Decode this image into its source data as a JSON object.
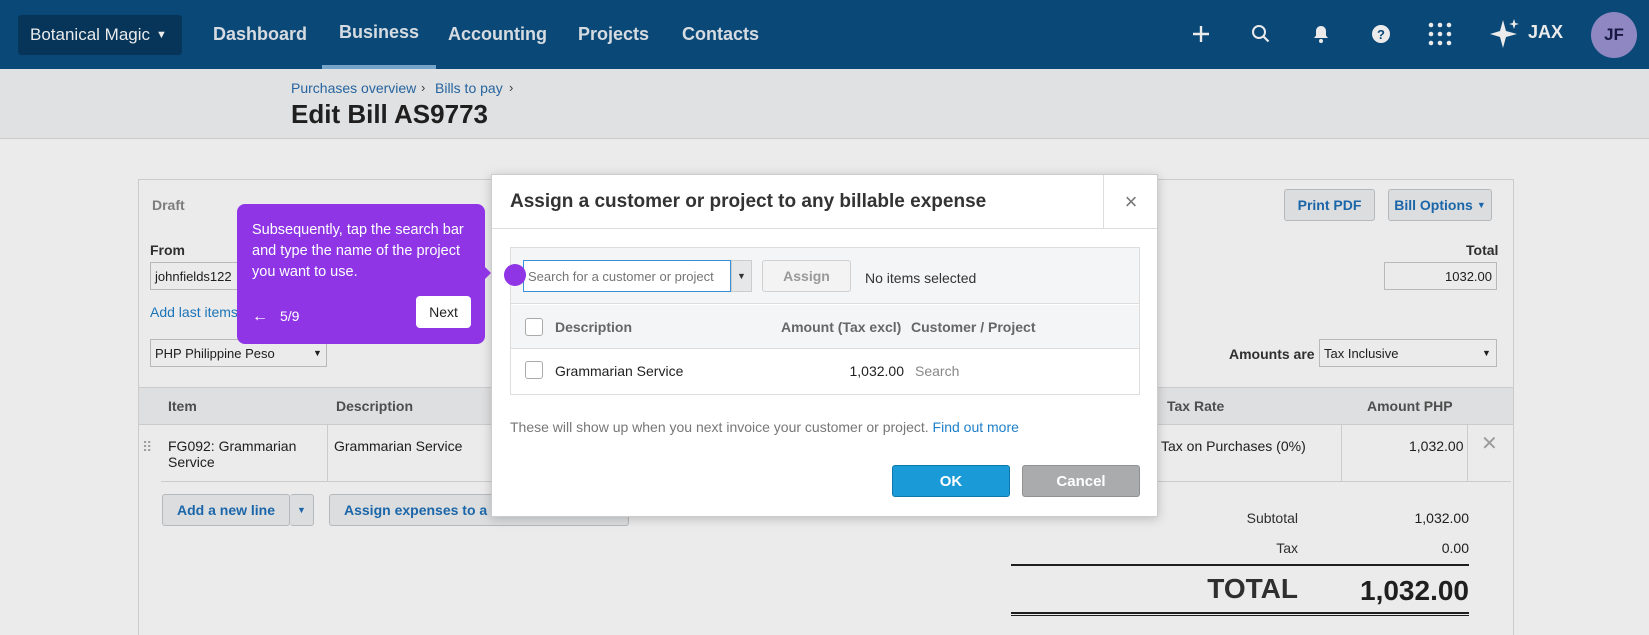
{
  "topbar": {
    "org_name": "Botanical Magic",
    "nav": [
      "Dashboard",
      "Business",
      "Accounting",
      "Projects",
      "Contacts"
    ],
    "active_nav": "Business",
    "assistant_label": "JAX",
    "avatar_initials": "JF"
  },
  "breadcrumb": {
    "items": [
      "Purchases overview",
      "Bills to pay"
    ]
  },
  "page_title": "Edit Bill AS9773",
  "bill": {
    "status": "Draft",
    "print_pdf_label": "Print PDF",
    "bill_options_label": "Bill Options",
    "from_label": "From",
    "from_value": "johnfields122",
    "add_last_items_label": "Add last items",
    "currency_value": "PHP Philippine Peso",
    "total_label": "Total",
    "total_value": "1032.00",
    "amounts_are_label": "Amounts are",
    "amounts_are_value": "Tax Inclusive",
    "columns": {
      "item": "Item",
      "description": "Description",
      "tax_rate": "Tax Rate",
      "amount": "Amount PHP"
    },
    "line": {
      "item": "FG092: Grammarian Service",
      "description": "Grammarian Service",
      "tax_rate": "Tax on Purchases (0%)",
      "amount": "1,032.00"
    },
    "add_line_label": "Add a new line",
    "assign_expenses_label": "Assign expenses to a c",
    "subtotal_label": "Subtotal",
    "subtotal_value": "1,032.00",
    "tax_label": "Tax",
    "tax_value": "0.00",
    "grand_total_label": "TOTAL",
    "grand_total_value": "1,032.00"
  },
  "modal": {
    "title": "Assign a customer or project to any billable expense",
    "close_glyph": "×",
    "search_placeholder": "Search for a customer or project",
    "assign_label": "Assign",
    "selection_status": "No items selected",
    "columns": {
      "description": "Description",
      "amount": "Amount (Tax excl)",
      "customer_project": "Customer / Project"
    },
    "row": {
      "description": "Grammarian Service",
      "amount": "1,032.00",
      "customer_placeholder": "Search"
    },
    "hint_text": "These will show up when you next invoice your customer or project.",
    "hint_link": "Find out more",
    "ok_label": "OK",
    "cancel_label": "Cancel"
  },
  "tooltip": {
    "text": "Subsequently, tap the search bar and type the name of the project you want to use.",
    "step": "5/9",
    "next_label": "Next",
    "back_glyph": "←"
  },
  "colors": {
    "topbar": "#0b4f82",
    "tooltip": "#8f35e6",
    "ok_button": "#1a9bd7",
    "link": "#1e7fc8"
  }
}
